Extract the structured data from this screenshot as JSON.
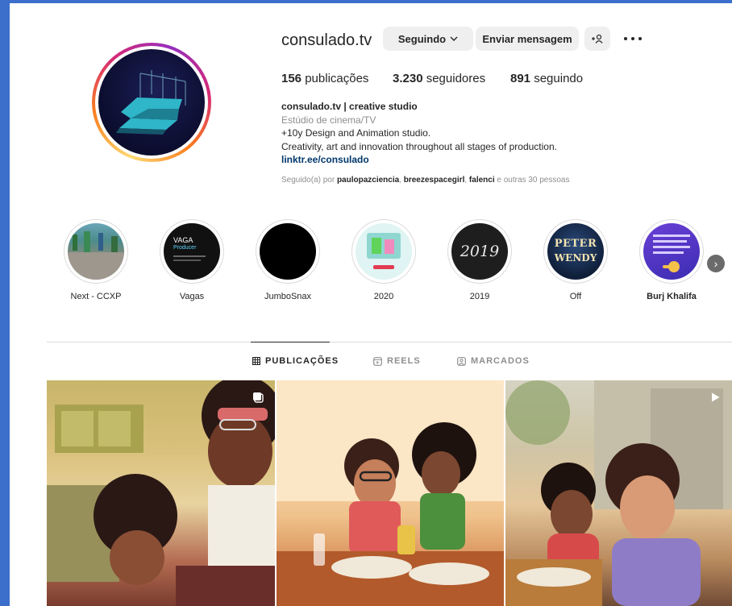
{
  "profile": {
    "username": "consulado.tv",
    "buttons": {
      "following": "Seguindo",
      "message": "Enviar mensagem",
      "suggest": "+♀"
    },
    "stats": {
      "posts_count": "156",
      "posts_label": "publicações",
      "followers_count": "3.230",
      "followers_label": "seguidores",
      "following_count": "891",
      "following_label": "seguindo"
    },
    "bio": {
      "name": "consulado.tv | creative studio",
      "category": "Estúdio de cinema/TV",
      "line1": "+10y Design and Animation studio.",
      "line2": "Creativity, art and innovation throughout all stages of production.",
      "link": "linktr.ee/consulado"
    },
    "followed_by": {
      "prefix": "Seguido(a) por",
      "user1": "paulopazciencia",
      "user2": "breezespacegirl",
      "user3": "falenci",
      "suffix": "e outras 30 pessoas"
    }
  },
  "highlights": [
    {
      "label": "Next - CCXP"
    },
    {
      "label": "Vagas"
    },
    {
      "label": "JumboSnax"
    },
    {
      "label": "2020"
    },
    {
      "label": "2019"
    },
    {
      "label": "Off"
    },
    {
      "label": "Burj Khalifa"
    }
  ],
  "highlight_texts": {
    "vaga_title": "VAGA",
    "vaga_sub": "Producer",
    "year_2019": "2019",
    "peter": "PETER",
    "wendy": "WENDY"
  },
  "tabs": [
    {
      "label": "PUBLICAÇÕES",
      "active": true
    },
    {
      "label": "REELS",
      "active": false
    },
    {
      "label": "MARCADOS",
      "active": false
    }
  ],
  "colors": {
    "link": "#00376b",
    "muted": "#8e8e8e",
    "button_bg": "#efefef",
    "frame": "#3b6fcb"
  }
}
